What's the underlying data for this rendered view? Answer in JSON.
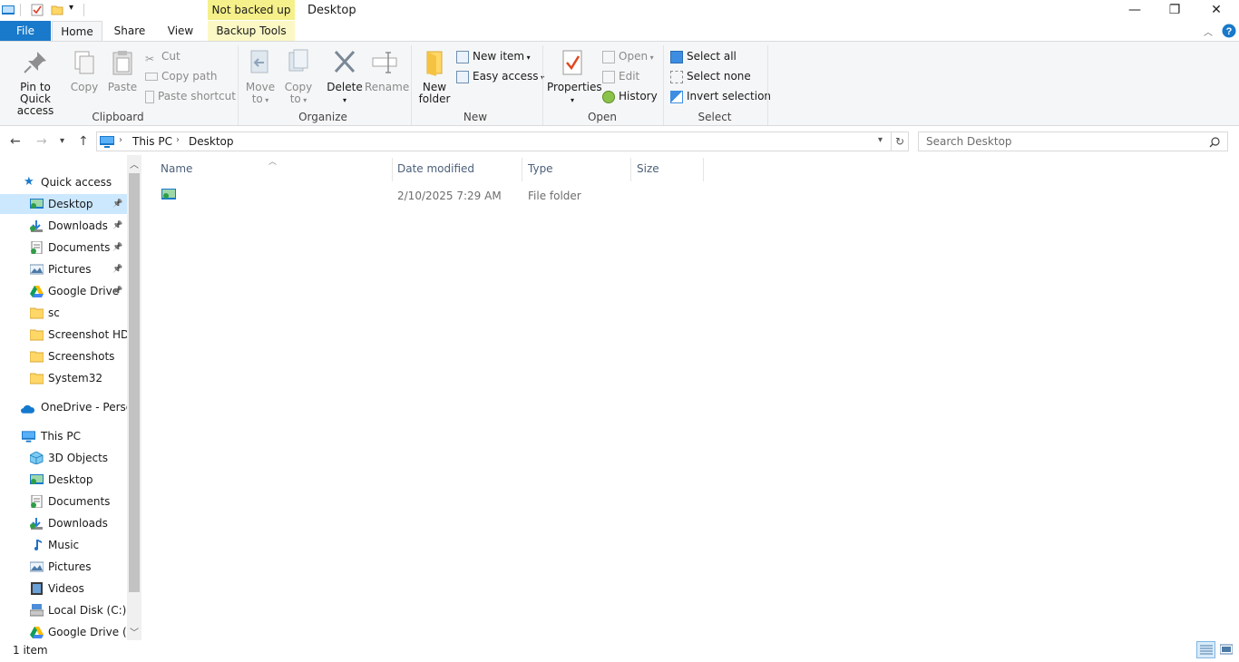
{
  "window": {
    "title": "Desktop",
    "context_tab_label": "Not backed up",
    "controls": {
      "minimize": "—",
      "restore": "❐",
      "close": "✕"
    }
  },
  "tabs": {
    "file": "File",
    "home": "Home",
    "share": "Share",
    "view": "View",
    "backup_tools": "Backup Tools"
  },
  "ribbon": {
    "clipboard": {
      "label": "Clipboard",
      "pin": "Pin to Quick access",
      "pin_l1": "Pin to Quick",
      "pin_l2": "access",
      "copy": "Copy",
      "paste": "Paste",
      "cut": "Cut",
      "copy_path": "Copy path",
      "paste_shortcut": "Paste shortcut"
    },
    "organize": {
      "label": "Organize",
      "move_l1": "Move",
      "move_l2": "to",
      "copy_l1": "Copy",
      "copy_l2": "to",
      "delete": "Delete",
      "rename": "Rename"
    },
    "new": {
      "label": "New",
      "new_folder_l1": "New",
      "new_folder_l2": "folder",
      "new_item": "New item",
      "easy_access": "Easy access"
    },
    "open": {
      "label": "Open",
      "properties": "Properties",
      "open": "Open",
      "edit": "Edit",
      "history": "History"
    },
    "select": {
      "label": "Select",
      "select_all": "Select all",
      "select_none": "Select none",
      "invert_selection": "Invert selection"
    }
  },
  "address": {
    "crumbs": [
      "This PC",
      "Desktop"
    ],
    "search_placeholder": "Search Desktop"
  },
  "nav": {
    "quick_access": "Quick access",
    "quick_items": [
      {
        "label": "Desktop",
        "icon": "desktop-icon",
        "pinned": true
      },
      {
        "label": "Downloads",
        "icon": "downloads-icon",
        "pinned": true
      },
      {
        "label": "Documents",
        "icon": "documents-icon",
        "pinned": true
      },
      {
        "label": "Pictures",
        "icon": "pictures-icon",
        "pinned": true
      },
      {
        "label": "Google Drive",
        "icon": "google-drive-icon",
        "pinned": true
      },
      {
        "label": "sc",
        "icon": "folder-icon",
        "pinned": false
      },
      {
        "label": "Screenshot HD",
        "icon": "folder-icon",
        "pinned": false
      },
      {
        "label": "Screenshots",
        "icon": "folder-icon",
        "pinned": false
      },
      {
        "label": "System32",
        "icon": "folder-icon",
        "pinned": false
      }
    ],
    "onedrive": "OneDrive - Persor",
    "this_pc": "This PC",
    "pc_items": [
      {
        "label": "3D Objects",
        "icon": "3d-objects-icon"
      },
      {
        "label": "Desktop",
        "icon": "desktop-icon"
      },
      {
        "label": "Documents",
        "icon": "documents-icon"
      },
      {
        "label": "Downloads",
        "icon": "downloads-icon"
      },
      {
        "label": "Music",
        "icon": "music-icon"
      },
      {
        "label": "Pictures",
        "icon": "pictures-icon"
      },
      {
        "label": "Videos",
        "icon": "videos-icon"
      },
      {
        "label": "Local Disk (C:)",
        "icon": "local-disk-icon"
      },
      {
        "label": "Google Drive (G:",
        "icon": "google-drive-icon"
      }
    ]
  },
  "files": {
    "columns": {
      "name": "Name",
      "date": "Date modified",
      "type": "Type",
      "size": "Size"
    },
    "rows": [
      {
        "name": "",
        "date": "2/10/2025 7:29 AM",
        "type": "File folder",
        "size": ""
      }
    ]
  },
  "status": {
    "item_count": "1 item"
  },
  "colors": {
    "accent": "#1979ca",
    "selection": "#cce8ff",
    "context_tab": "#f5f08a"
  }
}
